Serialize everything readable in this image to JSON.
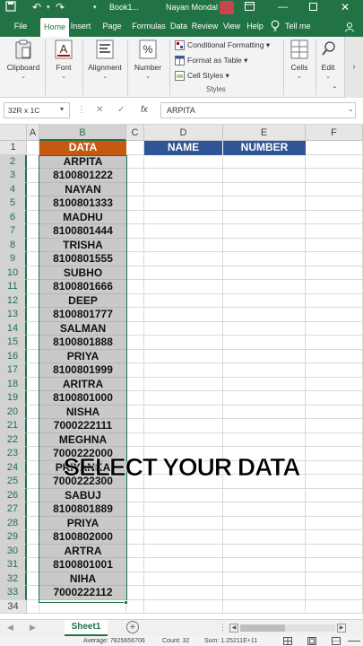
{
  "app": {
    "title": "Book1...",
    "user": "Nayan Mondal"
  },
  "tabs": [
    "File",
    "Home",
    "Insert",
    "Page Layo",
    "Formulas",
    "Data",
    "Review",
    "View",
    "Help",
    "Tell me"
  ],
  "active_tab": "Home",
  "ribbon": {
    "clipboard": "Clipboard",
    "font": "Font",
    "alignment": "Alignment",
    "number": "Number",
    "cond_format": "Conditional Formatting",
    "format_table": "Format as Table",
    "cell_styles": "Cell Styles",
    "styles_group": "Styles",
    "cells": "Cells",
    "editing": "Edit"
  },
  "formula_bar": {
    "name_box": "32R x 1C",
    "formula": "ARPITA",
    "fx": "fx"
  },
  "columns": [
    "A",
    "B",
    "C",
    "D",
    "E",
    "F"
  ],
  "rows": [
    "1",
    "2",
    "3",
    "4",
    "5",
    "6",
    "7",
    "8",
    "9",
    "10",
    "11",
    "12",
    "13",
    "14",
    "15",
    "16",
    "17",
    "18",
    "19",
    "20",
    "21",
    "22",
    "23",
    "24",
    "25",
    "26",
    "27",
    "28",
    "29",
    "30",
    "31",
    "32",
    "33",
    "34"
  ],
  "headers": {
    "data": "DATA",
    "name": "NAME",
    "number": "NUMBER"
  },
  "data_column": [
    "ARPITA",
    "8100801222",
    "NAYAN",
    "8100801333",
    "MADHU",
    "8100801444",
    "TRISHA",
    "8100801555",
    "SUBHO",
    "8100801666",
    "DEEP",
    "8100801777",
    "SALMAN",
    "8100801888",
    "PRIYA",
    "8100801999",
    "ARITRA",
    "8100801000",
    "NISHA",
    "7000222111",
    "MEGHNA",
    "7000222000",
    "PRIYANKA",
    "7000222300",
    "SABUJ",
    "8100801889",
    "PRIYA",
    "8100802000",
    "ARTRA",
    "8100801001",
    "NIHA",
    "7000222112"
  ],
  "overlay_text": "SELECT YOUR DATA",
  "sheet_tab": "Sheet1",
  "status": {
    "average": "Average: 7825656706",
    "count": "Count: 32",
    "sum": "Sum: 1.25211E+11"
  },
  "colors": {
    "excel_green": "#217346",
    "data_header": "#c65911",
    "table_header": "#2f5597",
    "selection": "#c9c9c9"
  }
}
